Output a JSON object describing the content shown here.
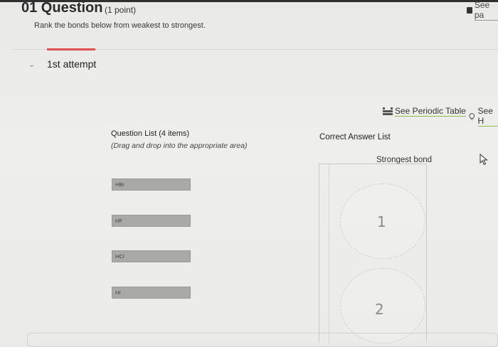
{
  "question": {
    "number_title": "01 Question",
    "points": "(1 point)",
    "prompt": "Rank the bonds below from weakest to strongest."
  },
  "top_right_link": "See pa",
  "attempt": {
    "label": "1st attempt"
  },
  "links": {
    "periodic_table": "See Periodic Table",
    "see_hint": "See H"
  },
  "question_list": {
    "title": "Question List (4 items)",
    "hint": "(Drag and drop into the appropriate area)",
    "items": [
      "HBr",
      "HF",
      "HCl",
      "HI"
    ]
  },
  "answer_list": {
    "title": "Correct Answer List",
    "top_label": "Strongest bond",
    "slots": [
      "1",
      "2"
    ]
  },
  "colors": {
    "accent_red": "#e05050",
    "link_underline": "#8cbf4a",
    "item_bg": "#a9a9a7"
  }
}
